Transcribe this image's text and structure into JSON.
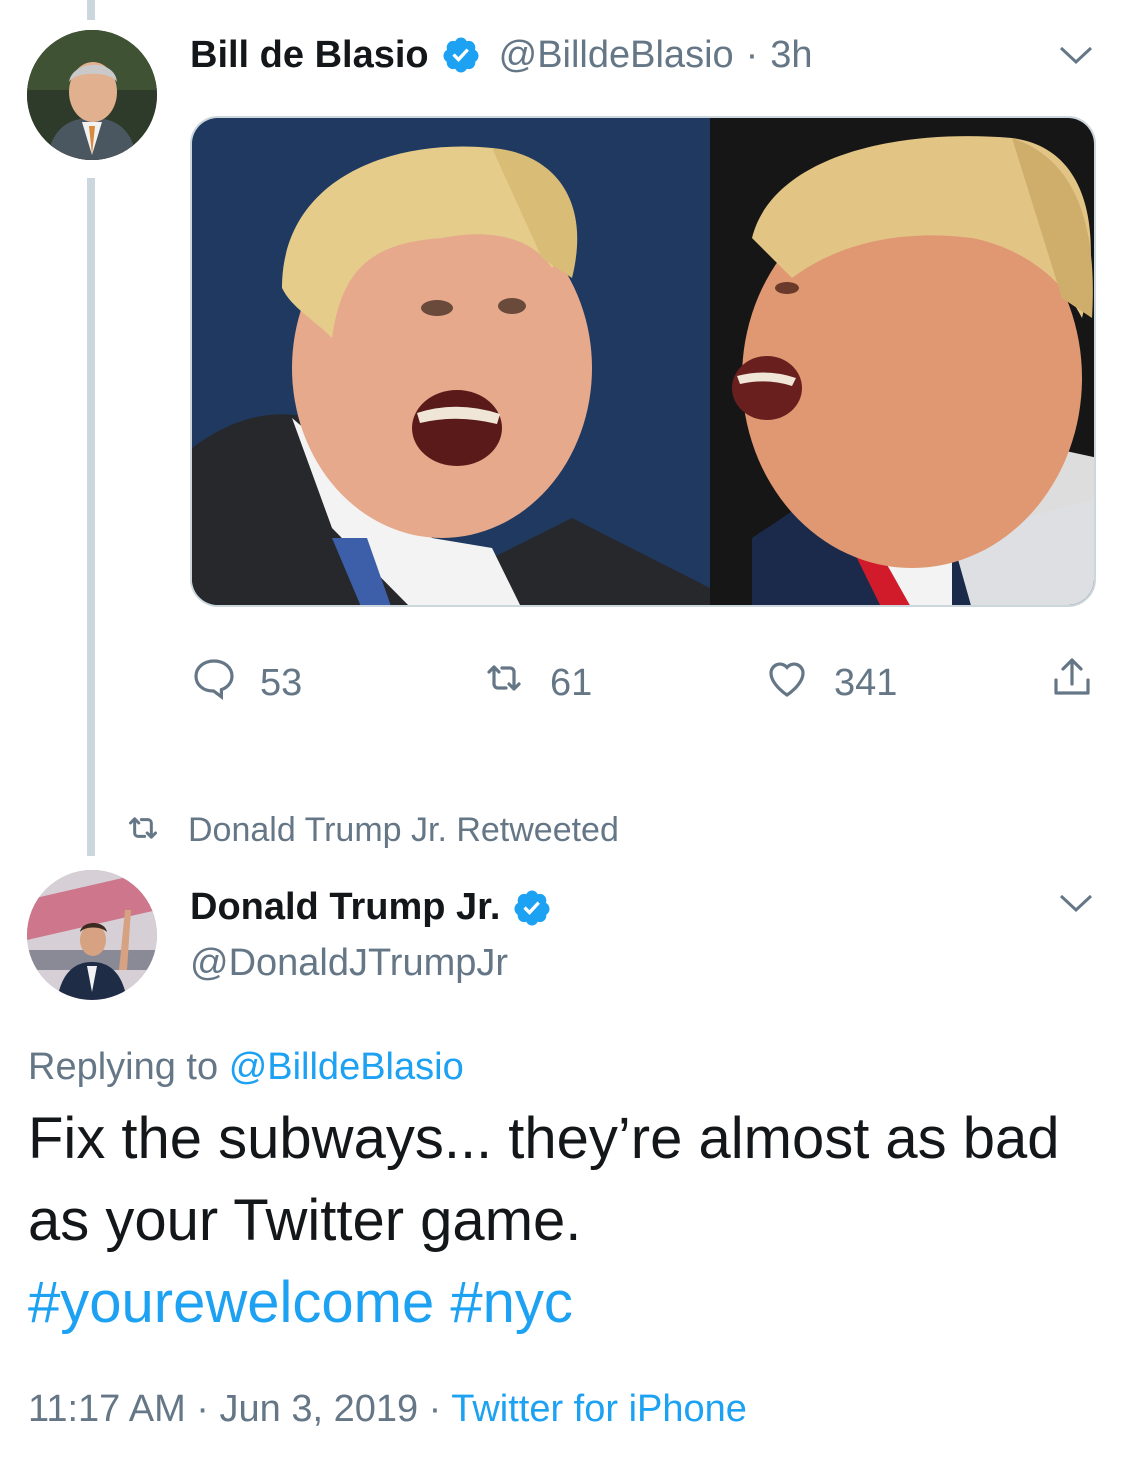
{
  "original_tweet": {
    "author_name": "Bill de Blasio",
    "handle": "@BilldeBlasio",
    "separator": "·",
    "time": "3h",
    "media_description_icon": "photo-collage",
    "actions": {
      "replies": "53",
      "retweets": "61",
      "likes": "341"
    }
  },
  "retweet_banner": {
    "text": "Donald Trump Jr. Retweeted"
  },
  "reply_tweet": {
    "author_name": "Donald Trump Jr.",
    "handle": "@DonaldJTrumpJr",
    "replying_label": "Replying to",
    "replying_handle": "@BilldeBlasio",
    "text": "Fix the subways... they’re almost as bad as your Twitter game.",
    "hashtags": [
      "#yourewelcome",
      "#nyc"
    ],
    "timestamp": "11:17 AM · Jun 3, 2019 · ",
    "source": "Twitter for iPhone"
  },
  "colors": {
    "accent": "#1da1f2",
    "secondary_text": "#657786",
    "thread_line": "#ccd6dd"
  }
}
